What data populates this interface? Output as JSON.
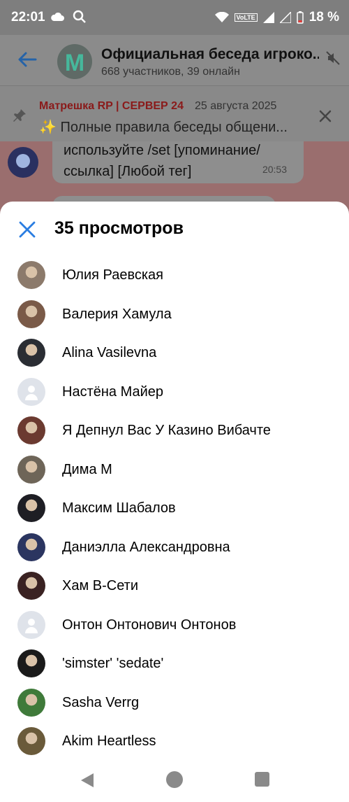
{
  "status": {
    "time": "22:01",
    "battery": "18 %",
    "volte": "VoLTE"
  },
  "chat": {
    "title": "Официальная беседа игроко...",
    "subtitle": "668 участников, 39 онлайн"
  },
  "pinned": {
    "author": "Матрешка RP | СЕРВЕР 24",
    "date": "25 августа 2025",
    "text": "✨ Полные правила беседы общени..."
  },
  "message": {
    "text": "используйте /set [упоминание/ссылка] [Любой тег]",
    "time": "20:53"
  },
  "sheet": {
    "title": "35 просмотров",
    "viewers": [
      {
        "name": "Юлия Раевская",
        "avatar": "photo",
        "color": "#8c7a6b"
      },
      {
        "name": "Валерия Хамула",
        "avatar": "photo",
        "color": "#7a5a48"
      },
      {
        "name": "Alina Vasilevna",
        "avatar": "photo",
        "color": "#2a2d33"
      },
      {
        "name": "Настёна Майер",
        "avatar": "default",
        "color": "#dfe3ea"
      },
      {
        "name": "Я Депнул Вас У Казино Вибачте",
        "avatar": "photo",
        "color": "#6b3a30"
      },
      {
        "name": "Дима М",
        "avatar": "photo",
        "color": "#6e6558"
      },
      {
        "name": "Максим Шабалов",
        "avatar": "photo",
        "color": "#1e1e24"
      },
      {
        "name": "Даниэлла Александровна",
        "avatar": "photo",
        "color": "#2b3560"
      },
      {
        "name": "Хам В-Сети",
        "avatar": "photo",
        "color": "#3a2222"
      },
      {
        "name": "Онтон Онтонович Онтонов",
        "avatar": "default",
        "color": "#dfe3ea"
      },
      {
        "name": "'simster' 'sedate'",
        "avatar": "photo",
        "color": "#1a1a1a"
      },
      {
        "name": "Sasha Verrg",
        "avatar": "photo",
        "color": "#3f7a3a"
      },
      {
        "name": "Akim Heartless",
        "avatar": "photo",
        "color": "#6a5a3a"
      }
    ]
  },
  "colors": {
    "accent": "#2a7de1",
    "pinned_author": "#c0242b"
  }
}
